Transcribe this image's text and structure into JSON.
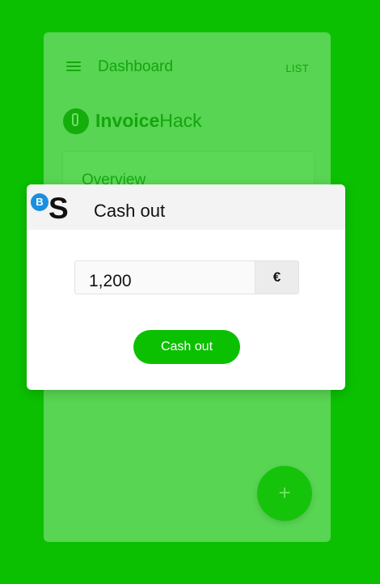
{
  "topbar": {
    "title": "Dashboard",
    "list_label": "LIST"
  },
  "brand": {
    "name_bold": "Invoice",
    "name_light": "Hack"
  },
  "overview": {
    "title": "Overview"
  },
  "fab": {
    "icon": "plus-icon",
    "glyph": "+"
  },
  "dialog": {
    "badge": "B",
    "logo": "S",
    "title": "Cash out",
    "amount_value": "1,200",
    "currency": "€",
    "button_label": "Cash out"
  },
  "colors": {
    "background": "#0bc000",
    "card": "#58d553",
    "badge": "#1a8fe0",
    "button": "#0bc000"
  }
}
